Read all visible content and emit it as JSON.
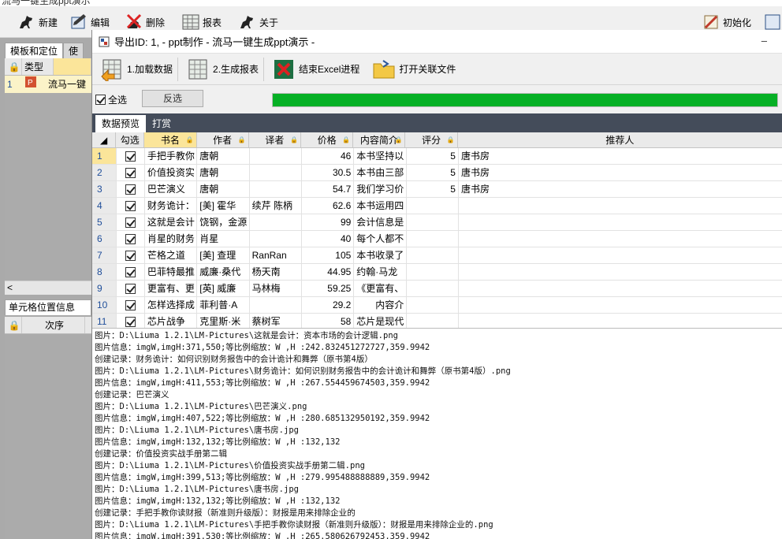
{
  "window": {
    "title_partial": "流马一键生成ppt演示"
  },
  "main_toolbar": {
    "new": "新建",
    "edit": "编辑",
    "delete": "删除",
    "report": "报表",
    "about": "关于",
    "init": "初始化"
  },
  "left_panel": {
    "tabs": [
      "模板和定位",
      "使"
    ],
    "grid": {
      "headers": [
        "类型"
      ],
      "rows": [
        {
          "num": "1",
          "name": "流马一键"
        }
      ]
    },
    "section2": "单元格位置信息",
    "grid2": {
      "headers": [
        "次序"
      ]
    },
    "scroll_arrow": "<"
  },
  "dialog": {
    "title": "导出ID: 1,  - ppt制作 - 流马一键生成ppt演示 -",
    "min_glyph": "–",
    "toolbar": {
      "load": "1.加载数据",
      "gen": "2.生成报表",
      "kill": "结束Excel进程",
      "open": "打开关联文件"
    },
    "select_all": "全选",
    "invert": "反选",
    "progress": 1.0,
    "tabs": [
      "数据预览",
      "打赏"
    ],
    "columns": [
      "勾选",
      "书名",
      "作者",
      "译者",
      "价格",
      "内容简介",
      "评分",
      "推荐人"
    ],
    "rows": [
      {
        "n": "1",
        "title": "手把手教你",
        "author": "唐朝",
        "translator": "",
        "price": "46",
        "desc": "本书坚持以",
        "score": "5",
        "rec": "唐书房"
      },
      {
        "n": "2",
        "title": "价值投资实",
        "author": "唐朝",
        "translator": "",
        "price": "30.5",
        "desc": "本书由三部",
        "score": "5",
        "rec": "唐书房"
      },
      {
        "n": "3",
        "title": "巴芒演义",
        "author": "唐朝",
        "translator": "",
        "price": "54.7",
        "desc": "我们学习价",
        "score": "5",
        "rec": "唐书房"
      },
      {
        "n": "4",
        "title": "财务诡计：",
        "author": "[美] 霍华",
        "translator": "续芹 陈柄",
        "price": "62.6",
        "desc": "本书运用四",
        "score": "",
        "rec": ""
      },
      {
        "n": "5",
        "title": "这就是会计",
        "author": "饶钢，金源",
        "translator": "",
        "price": "99",
        "desc": "会计信息是",
        "score": "",
        "rec": ""
      },
      {
        "n": "6",
        "title": "肖星的财务",
        "author": "肖星",
        "translator": "",
        "price": "40",
        "desc": "每个人都不",
        "score": "",
        "rec": ""
      },
      {
        "n": "7",
        "title": "芒格之道",
        "author": "[美] 查理",
        "translator": "RanRan",
        "price": "105",
        "desc": "本书收录了",
        "score": "",
        "rec": ""
      },
      {
        "n": "8",
        "title": "巴菲特最推",
        "author": "威廉·桑代",
        "translator": "杨天南",
        "price": "44.95",
        "desc": "约翰·马龙",
        "score": "",
        "rec": ""
      },
      {
        "n": "9",
        "title": "更富有、更",
        "author": "[英] 威廉",
        "translator": "马林梅",
        "price": "59.25",
        "desc": "《更富有、",
        "score": "",
        "rec": ""
      },
      {
        "n": "10",
        "title": "怎样选择成",
        "author": "菲利普·A",
        "translator": "",
        "price": "29.2",
        "desc": "　　内容介",
        "score": "",
        "rec": ""
      },
      {
        "n": "11",
        "title": "芯片战争",
        "author": "克里斯·米",
        "translator": "蔡树军",
        "price": "58",
        "desc": "芯片是现代",
        "score": "",
        "rec": ""
      }
    ],
    "log": [
      "图片：D:\\Liuma  1.2.1\\LM-Pictures\\这就是会计：资本市场的会计逻辑.png",
      "图片信息：imgW,imgH:371,550;等比例缩放：W ,H :242.832451272727,359.9942",
      "创建记录：财务诡计：如何识别财务报告中的会计诡计和舞弊（原书第4版）",
      "图片：D:\\Liuma  1.2.1\\LM-Pictures\\财务诡计：如何识别财务报告中的会计诡计和舞弊（原书第4版）.png",
      "图片信息：imgW,imgH:411,553;等比例缩放：W ,H :267.554459674503,359.9942",
      "创建记录：巴芒演义",
      "图片：D:\\Liuma  1.2.1\\LM-Pictures\\巴芒演义.png",
      "图片信息：imgW,imgH:407,522;等比例缩放：W ,H :280.685132950192,359.9942",
      "图片：D:\\Liuma  1.2.1\\LM-Pictures\\唐书房.jpg",
      "图片信息：imgW,imgH:132,132;等比例缩放：W ,H :132,132",
      "创建记录：价值投资实战手册第二辑",
      "图片：D:\\Liuma  1.2.1\\LM-Pictures\\价值投资实战手册第二辑.png",
      "图片信息：imgW,imgH:399,513;等比例缩放：W ,H :279.995488888889,359.9942",
      "图片：D:\\Liuma  1.2.1\\LM-Pictures\\唐书房.jpg",
      "图片信息：imgW,imgH:132,132;等比例缩放：W ,H :132,132",
      "创建记录：手把手教你读财报（新准则升级版）：财报是用来排除企业的",
      "图片：D:\\Liuma  1.2.1\\LM-Pictures\\手把手教你读财报（新准则升级版）：财报是用来排除企业的.png",
      "图片信息：imgW,imgH:391,530;等比例缩放：W ,H :265.580626792453,359.9942"
    ]
  }
}
